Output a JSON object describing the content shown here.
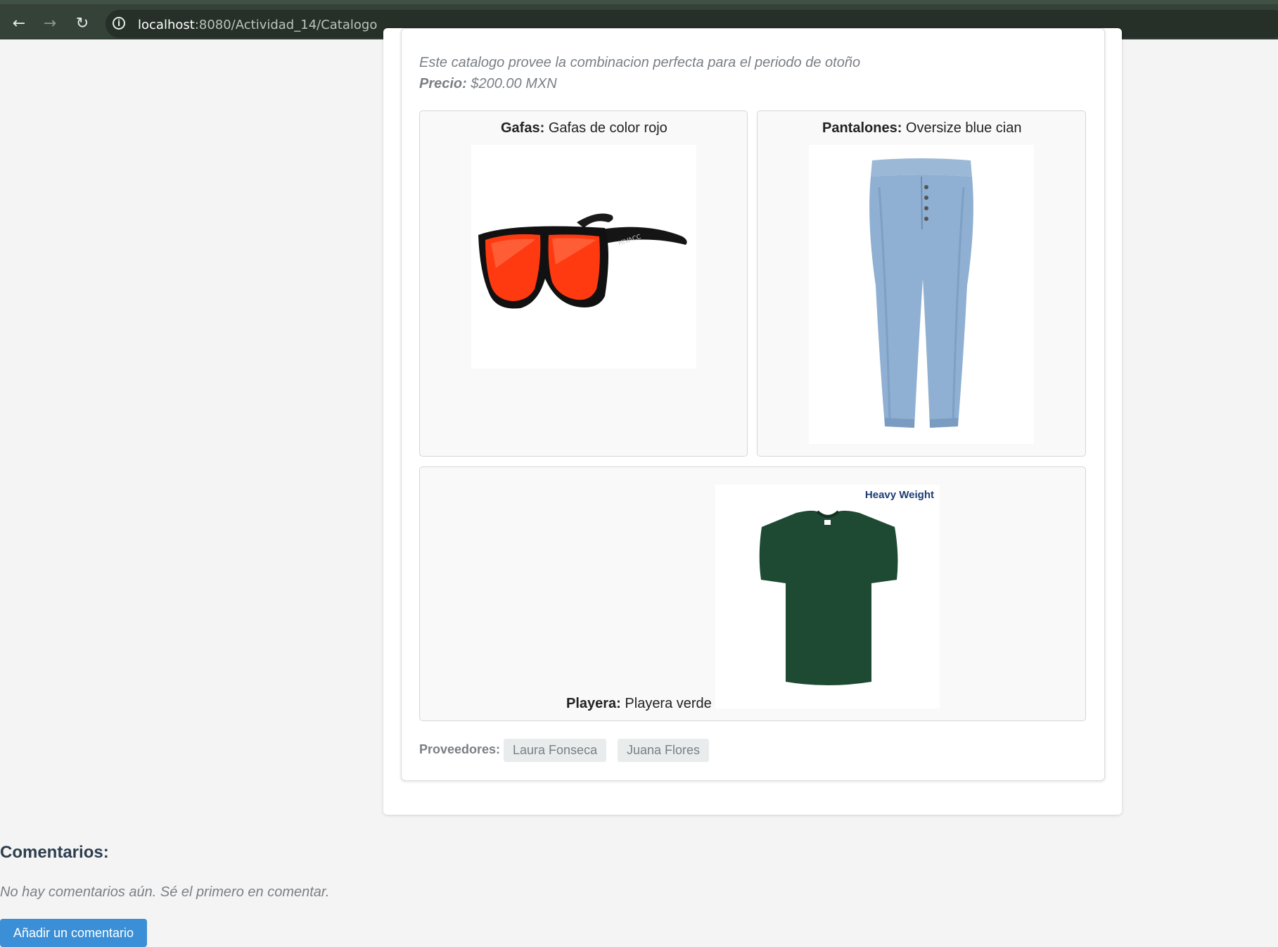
{
  "browser": {
    "url_host": "localhost",
    "url_path": ":8080/Actividad_14/Catalogo",
    "back_icon": "arrow-left-icon",
    "forward_icon": "arrow-right-icon",
    "reload_icon": "reload-icon",
    "info_icon": "info-icon"
  },
  "catalog": {
    "description": "Este catalogo provee la combinacion perfecta para el periodo de otoño",
    "price_label": "Precio:",
    "price_value": "$200.00 MXN",
    "items": [
      {
        "label": "Gafas:",
        "value": "Gafas de color rojo",
        "image": "red-sunglasses"
      },
      {
        "label": "Pantalones:",
        "value": "Oversize blue cian",
        "image": "blue-jeans"
      },
      {
        "label": "Playera:",
        "value": "Playera verde",
        "image": "green-tshirt",
        "image_text": "Heavy Weight"
      }
    ],
    "providers_label": "Proveedores:",
    "providers": [
      "Laura Fonseca",
      "Juana Flores"
    ]
  },
  "comments": {
    "title": "Comentarios:",
    "empty_text": "No hay comentarios aún. Sé el primero en comentar.",
    "add_button": "Añadir un comentario"
  },
  "colors": {
    "browser_bar": "#354238",
    "button": "#3b8fd6",
    "heading": "#2d3e50",
    "muted_text": "#7a7f84"
  }
}
